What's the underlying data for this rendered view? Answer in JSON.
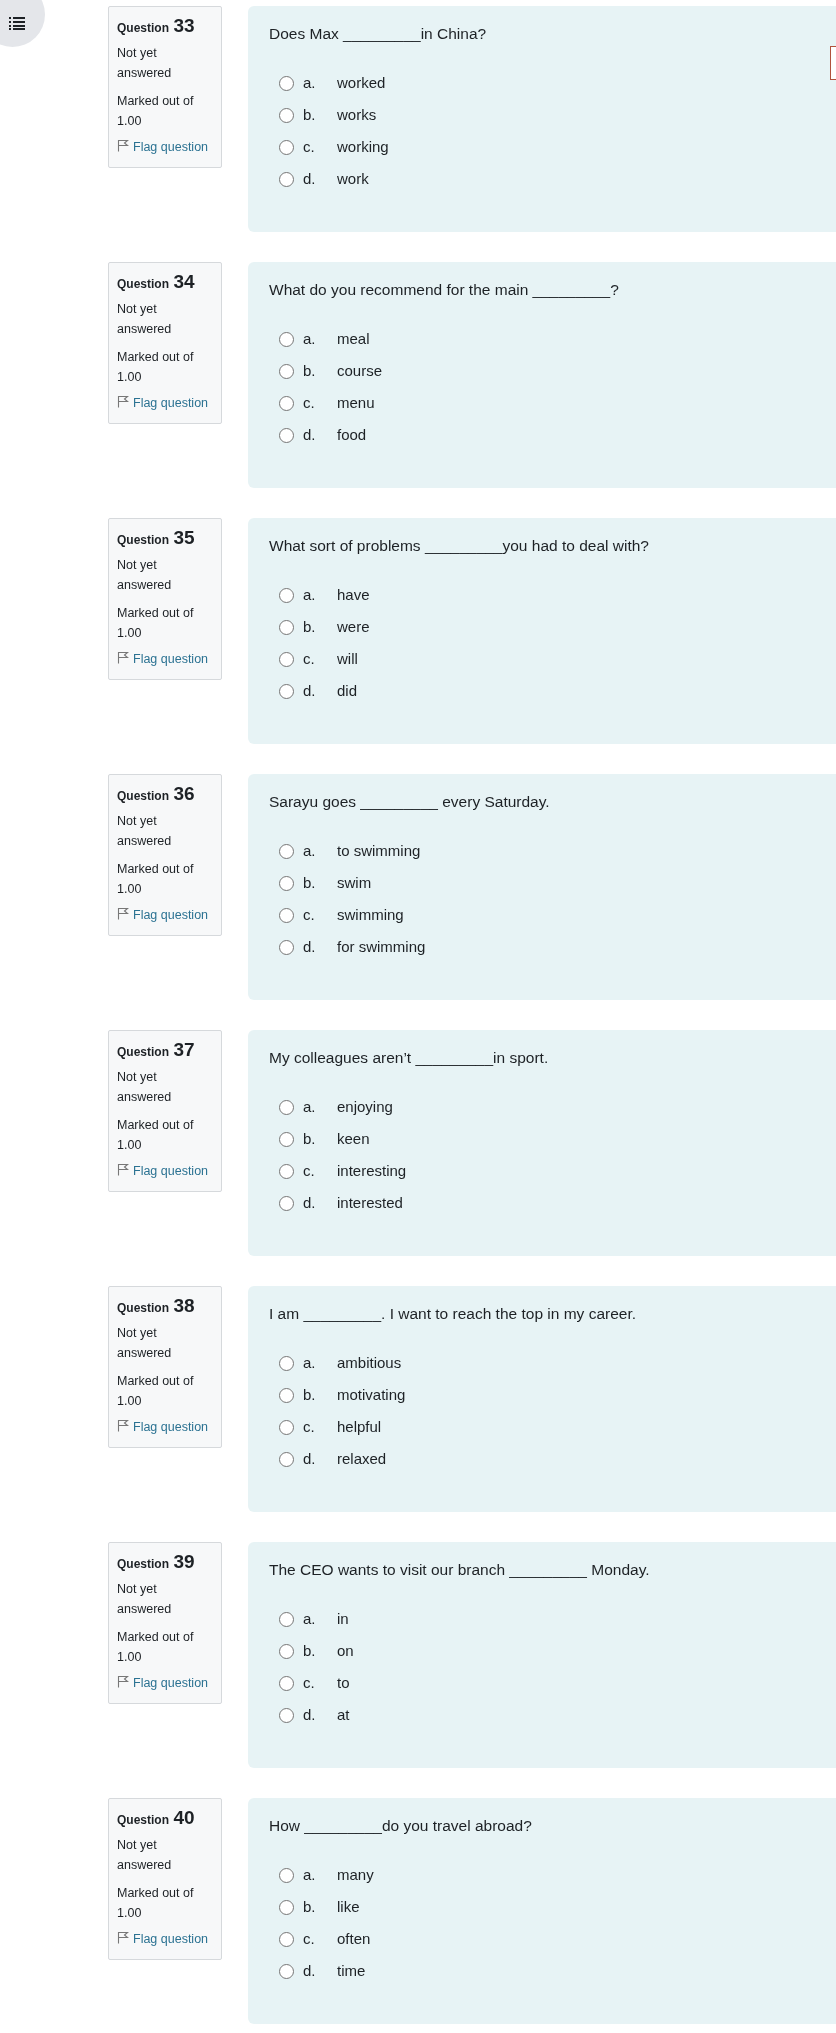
{
  "questions": [
    {
      "label": "Question",
      "number": "33",
      "status": "Not yet answered",
      "marks": "Marked out of 1.00",
      "flag": "Flag question",
      "flagged": false,
      "text": "Does Max _________in China?",
      "options": [
        {
          "letter": "a.",
          "text": "worked",
          "selected": false
        },
        {
          "letter": "b.",
          "text": "works",
          "selected": false
        },
        {
          "letter": "c.",
          "text": "working",
          "selected": false
        },
        {
          "letter": "d.",
          "text": "work",
          "selected": false
        }
      ]
    },
    {
      "label": "Question",
      "number": "34",
      "status": "Not yet answered",
      "marks": "Marked out of 1.00",
      "flag": "Flag question",
      "flagged": false,
      "text": "What do you recommend for the main _________?",
      "options": [
        {
          "letter": "a.",
          "text": "meal",
          "selected": false
        },
        {
          "letter": "b.",
          "text": "course",
          "selected": false
        },
        {
          "letter": "c.",
          "text": "menu",
          "selected": false
        },
        {
          "letter": "d.",
          "text": "food",
          "selected": false
        }
      ]
    },
    {
      "label": "Question",
      "number": "35",
      "status": "Not yet answered",
      "marks": "Marked out of 1.00",
      "flag": "Flag question",
      "flagged": false,
      "text": "What sort of problems _________you had to deal with?",
      "options": [
        {
          "letter": "a.",
          "text": "have",
          "selected": false
        },
        {
          "letter": "b.",
          "text": "were",
          "selected": false
        },
        {
          "letter": "c.",
          "text": "will",
          "selected": false
        },
        {
          "letter": "d.",
          "text": "did",
          "selected": false
        }
      ]
    },
    {
      "label": "Question",
      "number": "36",
      "status": "Not yet answered",
      "marks": "Marked out of 1.00",
      "flag": "Flag question",
      "flagged": false,
      "text": "Sarayu goes _________ every Saturday.",
      "options": [
        {
          "letter": "a.",
          "text": "to swimming",
          "selected": false
        },
        {
          "letter": "b.",
          "text": "swim",
          "selected": false
        },
        {
          "letter": "c.",
          "text": "swimming",
          "selected": false
        },
        {
          "letter": "d.",
          "text": "for swimming",
          "selected": false
        }
      ]
    },
    {
      "label": "Question",
      "number": "37",
      "status": "Not yet answered",
      "marks": "Marked out of 1.00",
      "flag": "Flag question",
      "flagged": false,
      "text": "My colleagues aren’t _________in sport.",
      "options": [
        {
          "letter": "a.",
          "text": "enjoying",
          "selected": false
        },
        {
          "letter": "b.",
          "text": "keen",
          "selected": false
        },
        {
          "letter": "c.",
          "text": "interesting",
          "selected": false
        },
        {
          "letter": "d.",
          "text": "interested",
          "selected": false
        }
      ]
    },
    {
      "label": "Question",
      "number": "38",
      "status": "Not yet answered",
      "marks": "Marked out of 1.00",
      "flag": "Flag question",
      "flagged": false,
      "text": "I am _________. I want to reach the top in my career.",
      "options": [
        {
          "letter": "a.",
          "text": "ambitious",
          "selected": false
        },
        {
          "letter": "b.",
          "text": "motivating",
          "selected": false
        },
        {
          "letter": "c.",
          "text": "helpful",
          "selected": false
        },
        {
          "letter": "d.",
          "text": "relaxed",
          "selected": false
        }
      ]
    },
    {
      "label": "Question",
      "number": "39",
      "status": "Not yet answered",
      "marks": "Marked out of 1.00",
      "flag": "Flag question",
      "flagged": false,
      "text": "The CEO wants to visit our branch _________ Monday.",
      "options": [
        {
          "letter": "a.",
          "text": "in",
          "selected": false
        },
        {
          "letter": "b.",
          "text": "on",
          "selected": false
        },
        {
          "letter": "c.",
          "text": "to",
          "selected": false
        },
        {
          "letter": "d.",
          "text": "at",
          "selected": false
        }
      ]
    },
    {
      "label": "Question",
      "number": "40",
      "status": "Not yet answered",
      "marks": "Marked out of 1.00",
      "flag": "Flag question",
      "flagged": false,
      "text": "How _________do you travel abroad?",
      "options": [
        {
          "letter": "a.",
          "text": "many",
          "selected": false
        },
        {
          "letter": "b.",
          "text": "like",
          "selected": false
        },
        {
          "letter": "c.",
          "text": "often",
          "selected": false
        },
        {
          "letter": "d.",
          "text": "time",
          "selected": false
        }
      ]
    }
  ]
}
